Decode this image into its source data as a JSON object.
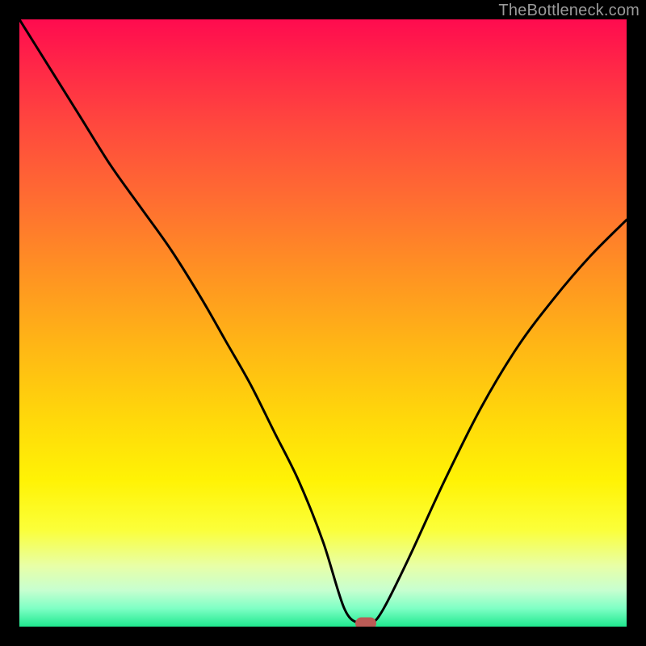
{
  "watermark": "TheBottleneck.com",
  "colors": {
    "background": "#000000",
    "curve_stroke": "#000000",
    "marker": "#bb5b56"
  },
  "chart_data": {
    "type": "line",
    "title": "",
    "xlabel": "",
    "ylabel": "",
    "xlim": [
      0,
      100
    ],
    "ylim": [
      0,
      100
    ],
    "grid": false,
    "legend": false,
    "series": [
      {
        "name": "bottleneck-curve",
        "x": [
          0,
          5,
          10,
          15,
          20,
          25,
          30,
          34,
          38,
          42,
          46,
          50,
          53.5,
          56,
          58,
          60,
          64,
          70,
          76,
          82,
          88,
          94,
          100
        ],
        "values": [
          100,
          92,
          84,
          76,
          69,
          62,
          54,
          47,
          40,
          32,
          24,
          14,
          3,
          0.5,
          0.5,
          3,
          11,
          24,
          36,
          46,
          54,
          61,
          67
        ]
      }
    ],
    "marker": {
      "x": 57,
      "y": 0.5
    },
    "gradient_stops": [
      {
        "pos": 0,
        "color": "#ff0b4f"
      },
      {
        "pos": 8,
        "color": "#ff2847"
      },
      {
        "pos": 18,
        "color": "#ff4a3d"
      },
      {
        "pos": 30,
        "color": "#ff6e31"
      },
      {
        "pos": 42,
        "color": "#ff9322"
      },
      {
        "pos": 54,
        "color": "#ffb715"
      },
      {
        "pos": 66,
        "color": "#ffd90a"
      },
      {
        "pos": 76,
        "color": "#fff305"
      },
      {
        "pos": 84,
        "color": "#fbff39"
      },
      {
        "pos": 90,
        "color": "#e8ffa7"
      },
      {
        "pos": 94,
        "color": "#c7ffd0"
      },
      {
        "pos": 97,
        "color": "#7effc5"
      },
      {
        "pos": 100,
        "color": "#1fe88e"
      }
    ]
  }
}
